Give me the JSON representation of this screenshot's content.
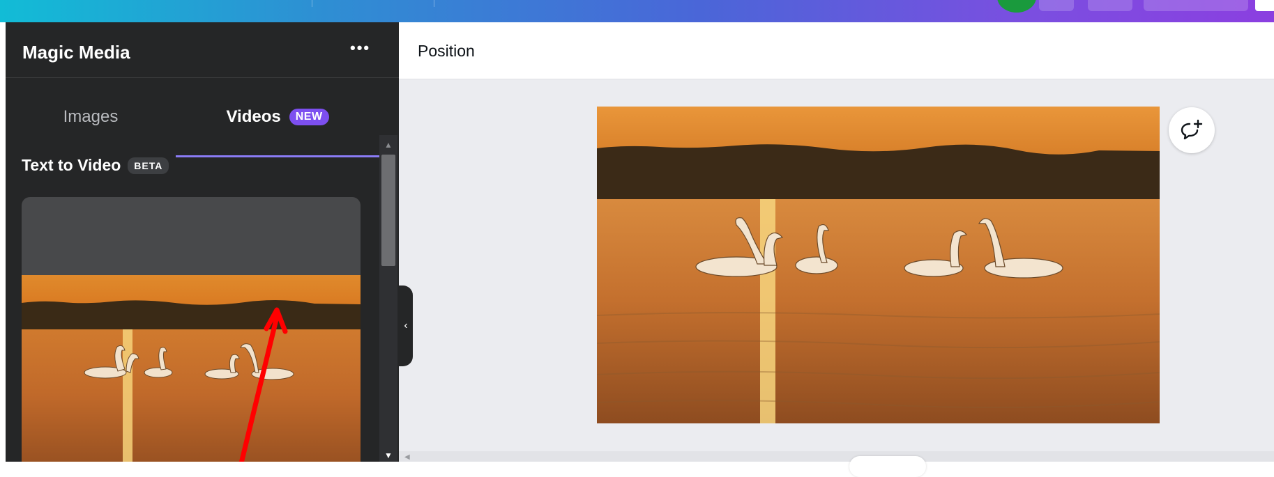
{
  "panel": {
    "title": "Magic Media",
    "more_label": "•••",
    "tabs": [
      {
        "label": "Images",
        "active": false
      },
      {
        "label": "Videos",
        "active": true,
        "badge": "NEW"
      }
    ],
    "section": {
      "title": "Text to Video",
      "badge": "BETA"
    }
  },
  "toolbar": {
    "position_label": "Position"
  },
  "icons": {
    "more": "more-horizontal-icon",
    "comment": "add-comment-icon",
    "collapse": "chevron-left-icon",
    "scroll_up": "caret-up-icon",
    "scroll_down": "caret-down-icon"
  },
  "colors": {
    "panel_bg": "#252627",
    "accent": "#8b7cf6",
    "new_badge": "#7d4ff0",
    "annotation_arrow": "#ff0000",
    "canvas_bg": "#ebecf0"
  }
}
